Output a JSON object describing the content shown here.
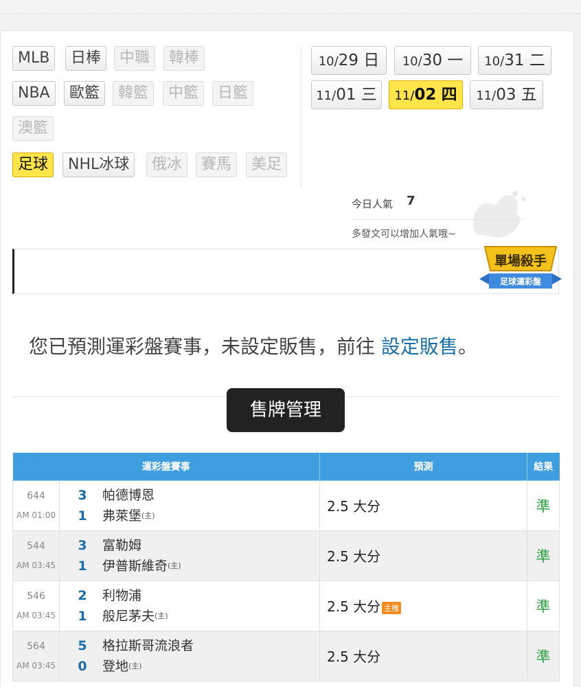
{
  "sports": {
    "row1": [
      {
        "label": "MLB",
        "state": "normal"
      },
      {
        "label": "日棒",
        "state": "normal"
      },
      {
        "label": "中職",
        "state": "disabled"
      },
      {
        "label": "韓棒",
        "state": "disabled"
      }
    ],
    "row2": [
      {
        "label": "NBA",
        "state": "normal"
      },
      {
        "label": "歐籃",
        "state": "normal"
      },
      {
        "label": "韓籃",
        "state": "disabled"
      },
      {
        "label": "中籃",
        "state": "disabled"
      },
      {
        "label": "日籃",
        "state": "disabled"
      }
    ],
    "row3": [
      {
        "label": "澳籃",
        "state": "disabled"
      }
    ],
    "row4": [
      {
        "label": "足球",
        "state": "active"
      },
      {
        "label": "NHL冰球",
        "state": "normal"
      },
      {
        "label": "俄冰",
        "state": "disabled"
      },
      {
        "label": "賽馬",
        "state": "disabled"
      },
      {
        "label": "美足",
        "state": "disabled"
      }
    ]
  },
  "dates": [
    {
      "month": "10/",
      "day": "29",
      "weekday": "日",
      "active": false
    },
    {
      "month": "10/",
      "day": "30",
      "weekday": "一",
      "active": false
    },
    {
      "month": "10/",
      "day": "31",
      "weekday": "二",
      "active": false
    },
    {
      "month": "11/",
      "day": "01",
      "weekday": "三",
      "active": false
    },
    {
      "month": "11/",
      "day": "02",
      "weekday": "四",
      "active": true
    },
    {
      "month": "11/",
      "day": "03",
      "weekday": "五",
      "active": false
    }
  ],
  "popularity": {
    "label": "今日人氣",
    "value": "7",
    "note": "多發文可以增加人氣哦~"
  },
  "badge": {
    "title": "單場殺手",
    "subtitle": "足球運彩盤"
  },
  "message": {
    "text": "您已預測運彩盤賽事，未設定販售，前往",
    "link": "設定販售",
    "end": "。"
  },
  "manage_button": "售牌管理",
  "table": {
    "headers": [
      "運彩盤賽事",
      "預測",
      "結果"
    ],
    "rows": [
      {
        "id": "644",
        "time": "AM 01:00",
        "away_score": "3",
        "away": "帕德博恩",
        "home_score": "1",
        "home": "弗萊堡",
        "home_tag": "(主)",
        "prediction": "2.5 大分",
        "pick_tag": "",
        "result": "準"
      },
      {
        "id": "544",
        "time": "AM 03:45",
        "away_score": "3",
        "away": "富勒姆",
        "home_score": "1",
        "home": "伊普斯維奇",
        "home_tag": "(主)",
        "prediction": "2.5 大分",
        "pick_tag": "",
        "result": "準"
      },
      {
        "id": "546",
        "time": "AM 03:45",
        "away_score": "2",
        "away": "利物浦",
        "home_score": "1",
        "home": "般尼茅夫",
        "home_tag": "(主)",
        "prediction": "2.5 大分",
        "pick_tag": "主推",
        "result": "準"
      },
      {
        "id": "564",
        "time": "AM 03:45",
        "away_score": "5",
        "away": "格拉斯哥流浪者",
        "home_score": "0",
        "home": "登地",
        "home_tag": "(主)",
        "prediction": "2.5 大分",
        "pick_tag": "",
        "result": "準"
      }
    ]
  },
  "colors": {
    "accent": "#3f9ee0",
    "active_chip": "#ffe54a",
    "link": "#1a6ea8",
    "result": "#2ea043"
  }
}
